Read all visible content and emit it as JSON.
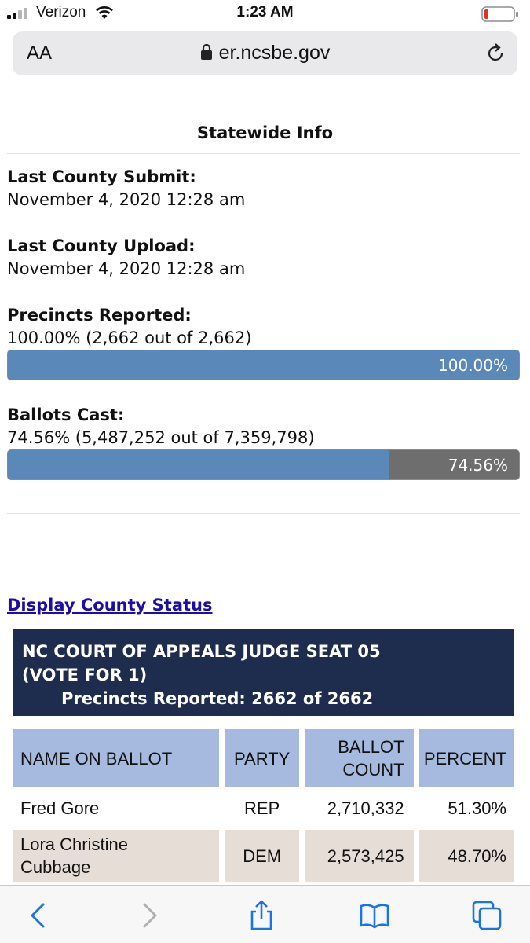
{
  "status_bar": {
    "carrier": "Verizon",
    "time": "1:23 AM",
    "icons": [
      "signal-icon",
      "wifi-icon",
      "battery-icon"
    ]
  },
  "browser": {
    "text_size_button": "AA",
    "url": "er.ncsbe.gov",
    "icons": [
      "lock-icon",
      "reload-icon"
    ]
  },
  "statewide": {
    "title": "Statewide Info",
    "last_county_submit": {
      "label": "Last County Submit:",
      "value": "November 4, 2020 12:28 am"
    },
    "last_county_upload": {
      "label": "Last County Upload:",
      "value": "November 4, 2020 12:28 am"
    },
    "precincts_reported": {
      "label": "Precincts Reported:",
      "value": "100.00% (2,662 out of 2,662)",
      "bar_label": "100.00%",
      "progress": 1.0
    },
    "ballots_cast": {
      "label": "Ballots Cast:",
      "value": "74.56% (5,487,252 out of 7,359,798)",
      "bar_label": "74.56%",
      "progress": 0.7456
    }
  },
  "display_county_status_link": "Display County Status",
  "contest": {
    "title_line1": "NC COURT OF APPEALS JUDGE SEAT 05",
    "title_line2": "(VOTE FOR 1)",
    "precincts_line": "Precincts Reported: 2662 of 2662",
    "columns": [
      "NAME ON BALLOT",
      "PARTY",
      "BALLOT COUNT",
      "PERCENT"
    ],
    "rows": [
      {
        "name": "Fred Gore",
        "party": "REP",
        "count": "2,710,332",
        "percent": "51.30%"
      },
      {
        "name": "Lora Christine Cubbage",
        "party": "DEM",
        "count": "2,573,425",
        "percent": "48.70%"
      }
    ]
  },
  "toolbar": {
    "icons": [
      "back-icon",
      "forward-icon",
      "share-icon",
      "bookmarks-icon",
      "tabs-icon"
    ]
  },
  "colors": {
    "bar_fill": "#5a88b8",
    "bar_remainder": "#6e6e6e",
    "contest_header_bg": "#1e2d4e",
    "table_header_bg": "#a6b9de",
    "alt_row_bg": "#e6ddd7",
    "link": "#1a0dab"
  }
}
